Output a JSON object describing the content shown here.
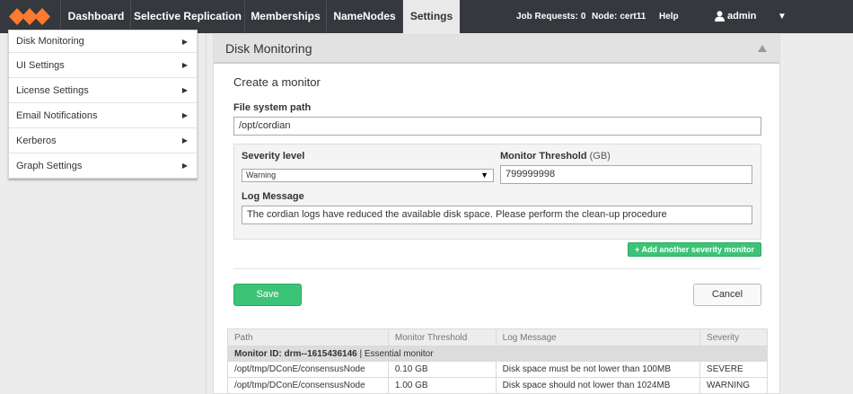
{
  "nav": {
    "tabs": [
      {
        "label": "Dashboard"
      },
      {
        "label": "Selective Replication"
      },
      {
        "label": "Memberships"
      },
      {
        "label": "NameNodes"
      },
      {
        "label": "Settings",
        "active": true
      }
    ],
    "job_requests_label": "Job Requests:",
    "job_requests_value": "0",
    "node_label": "Node:",
    "node_value": "cert11-",
    "help_label": "Help",
    "user_label": "admin",
    "user_icon": "user-icon",
    "caret_icon": "caret-down-icon",
    "logo_color": "#ff7a2f"
  },
  "sidebar": {
    "items": [
      {
        "label": "Disk Monitoring"
      },
      {
        "label": "UI Settings"
      },
      {
        "label": "License Settings"
      },
      {
        "label": "Email Notifications"
      },
      {
        "label": "Kerberos"
      },
      {
        "label": "Graph Settings"
      }
    ],
    "chevron_icon": "chevron-right-icon"
  },
  "panel": {
    "title": "Disk Monitoring",
    "collapse_icon": "triangle-up-icon"
  },
  "form": {
    "title": "Create a monitor",
    "path_label": "File system path",
    "path_value": "/opt/cordian",
    "severity_label": "Severity level",
    "severity_value": "Warning",
    "threshold_label": "Monitor Threshold",
    "threshold_unit": "(GB)",
    "threshold_value": "799999998",
    "log_label": "Log Message",
    "log_value": "The cordian logs have reduced the available disk space. Please perform the clean-up procedure",
    "add_label": "+ Add another severity monitor",
    "save_label": "Save",
    "cancel_label": "Cancel",
    "accent_color": "#3cc476"
  },
  "table": {
    "headers": [
      "Path",
      "Monitor Threshold",
      "Log Message",
      "Severity"
    ],
    "group_id_label": "Monitor ID: drm--1615436146",
    "group_suffix": "| Essential monitor",
    "rows": [
      {
        "path": "/opt/tmp/DConE/consensusNode",
        "threshold": "0.10 GB",
        "message": "Disk space must be not lower than 100MB",
        "severity": "SEVERE"
      },
      {
        "path": "/opt/tmp/DConE/consensusNode",
        "threshold": "1.00 GB",
        "message": "Disk space should not lower than 1024MB",
        "severity": "WARNING"
      }
    ]
  }
}
